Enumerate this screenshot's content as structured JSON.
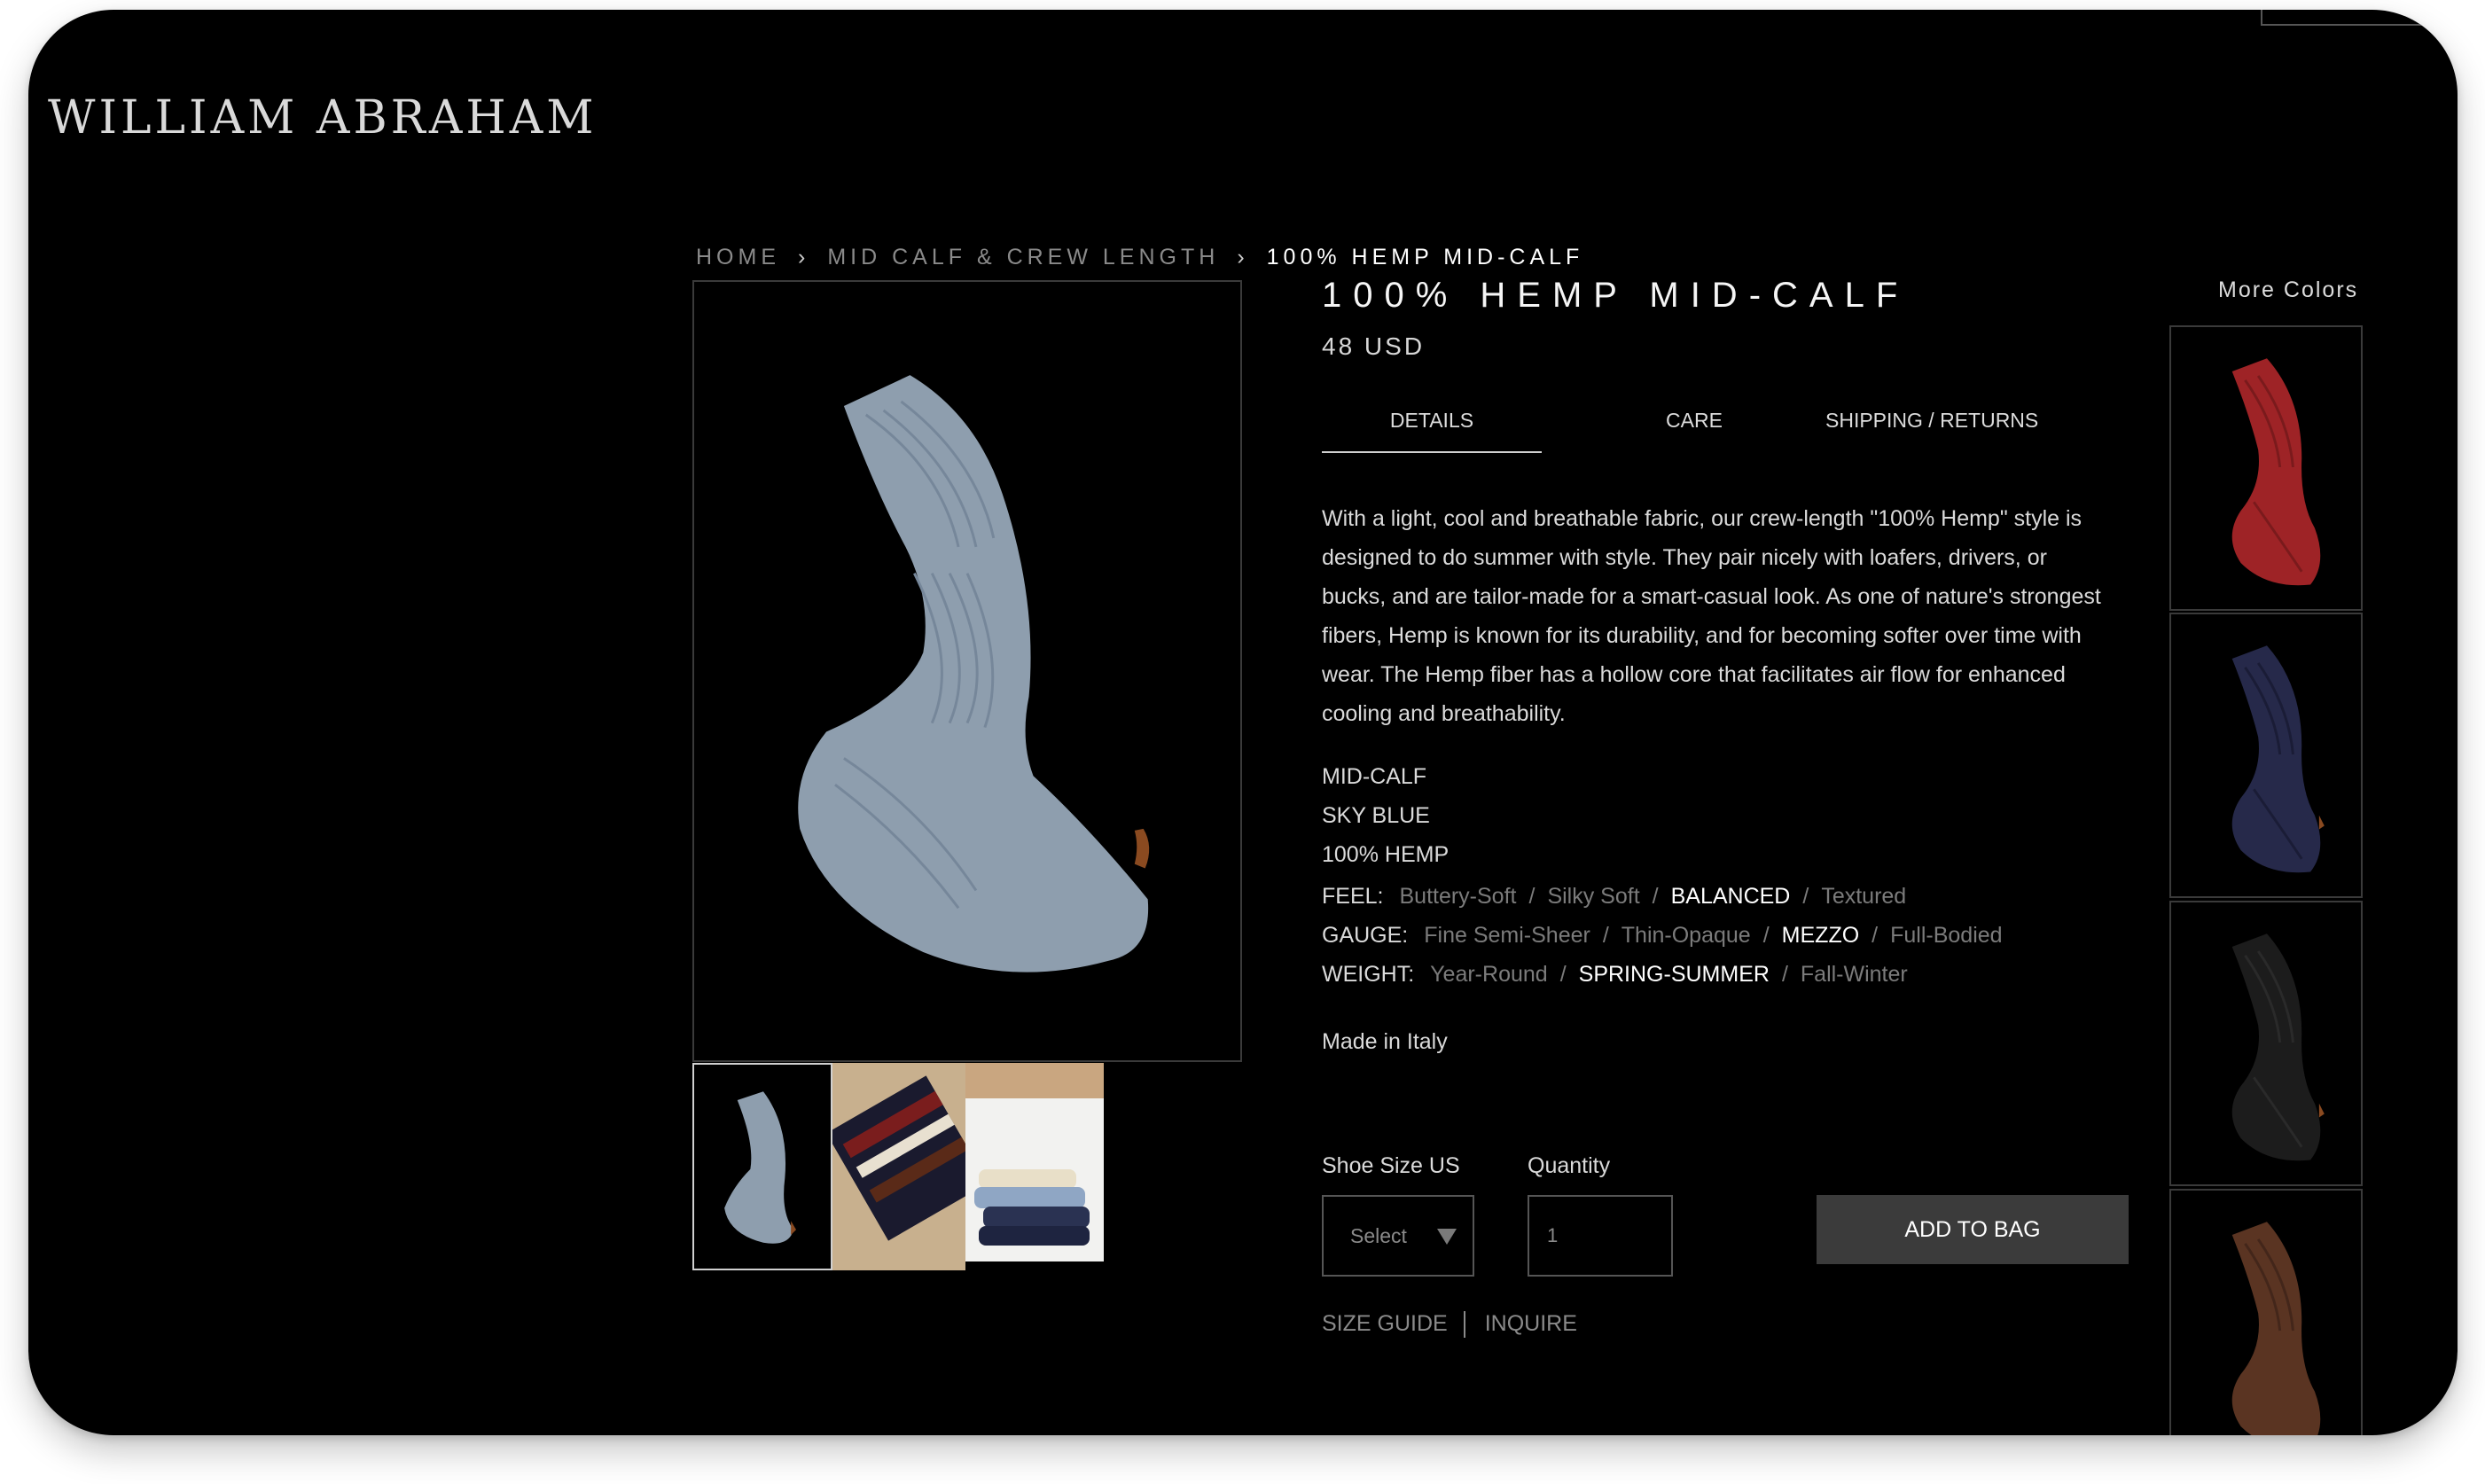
{
  "brand": {
    "logo": "WILLIAM ABRAHAM"
  },
  "breadcrumb": {
    "items": [
      "HOME",
      "MID CALF & CREW LENGTH",
      "100% HEMP MID-CALF"
    ],
    "separator": "›"
  },
  "product": {
    "title": "100% HEMP MID-CALF",
    "price": "48 USD",
    "tabs": [
      "DETAILS",
      "CARE",
      "SHIPPING / RETURNS"
    ],
    "active_tab": "DETAILS",
    "description": "With a light, cool and breathable fabric, our crew-length \"100% Hemp\" style is designed to do summer with style.  They pair nicely with loafers, drivers, or bucks, and are tailor-made for a smart-casual look.  As one of nature's strongest fibers, Hemp is known for its durability, and for becoming softer over time with wear.  The Hemp fiber has a hollow core that facilitates air flow for enhanced cooling and breathability.",
    "specs": [
      "MID-CALF",
      "SKY BLUE",
      "100% HEMP"
    ],
    "attributes": [
      {
        "label": "FEEL:",
        "options": [
          "Buttery-Soft",
          "Silky Soft",
          "BALANCED",
          "Textured"
        ],
        "selected": "BALANCED"
      },
      {
        "label": "GAUGE:",
        "options": [
          "Fine Semi-Sheer",
          "Thin-Opaque",
          "MEZZO",
          "Full-Bodied"
        ],
        "selected": "MEZZO"
      },
      {
        "label": "WEIGHT:",
        "options": [
          "Year-Round",
          "SPRING-SUMMER",
          "Fall-Winter"
        ],
        "selected": "SPRING-SUMMER"
      }
    ],
    "origin": "Made in Italy",
    "main_sock_color": "#8e9eae"
  },
  "purchase": {
    "shoe_size_label": "Shoe Size US",
    "shoe_size_value": "Select",
    "quantity_label": "Quantity",
    "quantity_value": "1",
    "add_to_bag": "ADD TO BAG",
    "size_guide": "SIZE GUIDE",
    "inquire": "INQUIRE"
  },
  "more_colors": {
    "label": "More Colors",
    "swatches": [
      {
        "name": "red",
        "color": "#9e2326"
      },
      {
        "name": "navy",
        "color": "#26294a"
      },
      {
        "name": "black",
        "color": "#1c1c1c"
      },
      {
        "name": "brown",
        "color": "#5a3422"
      }
    ]
  },
  "colors": {
    "background": "#000000",
    "button": "#3b3b3b",
    "muted": "#7b7b7b"
  }
}
